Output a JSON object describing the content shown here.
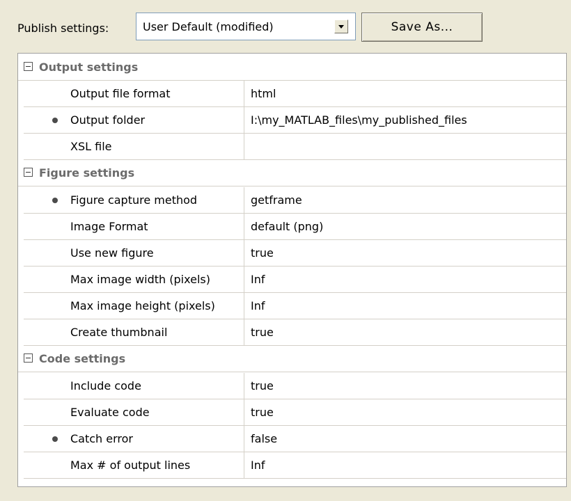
{
  "toolbar": {
    "label": "Publish settings:",
    "selected": "User Default (modified)",
    "save_as": "Save As..."
  },
  "sections": {
    "output": {
      "title": "Output settings",
      "rows": [
        {
          "name": "Output file format",
          "value": "html",
          "modified": false
        },
        {
          "name": "Output folder",
          "value": "I:\\my_MATLAB_files\\my_published_files",
          "modified": true
        },
        {
          "name": "XSL file",
          "value": "",
          "modified": false
        }
      ]
    },
    "figure": {
      "title": "Figure settings",
      "rows": [
        {
          "name": "Figure capture method",
          "value": "getframe",
          "modified": true
        },
        {
          "name": "Image Format",
          "value": "default (png)",
          "modified": false
        },
        {
          "name": "Use new figure",
          "value": "true",
          "modified": false
        },
        {
          "name": "Max image width (pixels)",
          "value": "Inf",
          "modified": false
        },
        {
          "name": "Max image height (pixels)",
          "value": "Inf",
          "modified": false
        },
        {
          "name": "Create thumbnail",
          "value": "true",
          "modified": false
        }
      ]
    },
    "code": {
      "title": "Code settings",
      "rows": [
        {
          "name": "Include code",
          "value": "true",
          "modified": false
        },
        {
          "name": "Evaluate code",
          "value": "true",
          "modified": false
        },
        {
          "name": "Catch error",
          "value": "false",
          "modified": true
        },
        {
          "name": "Max # of output lines",
          "value": "Inf",
          "modified": false
        }
      ]
    }
  },
  "icons": {
    "collapse": "minus-box-icon",
    "modified": "bullet-dot-icon",
    "dropdown": "chevron-down-icon"
  },
  "colors": {
    "background": "#ece9d8",
    "grid_line": "#d4d0c8",
    "category_text": "#6b6b6b"
  }
}
